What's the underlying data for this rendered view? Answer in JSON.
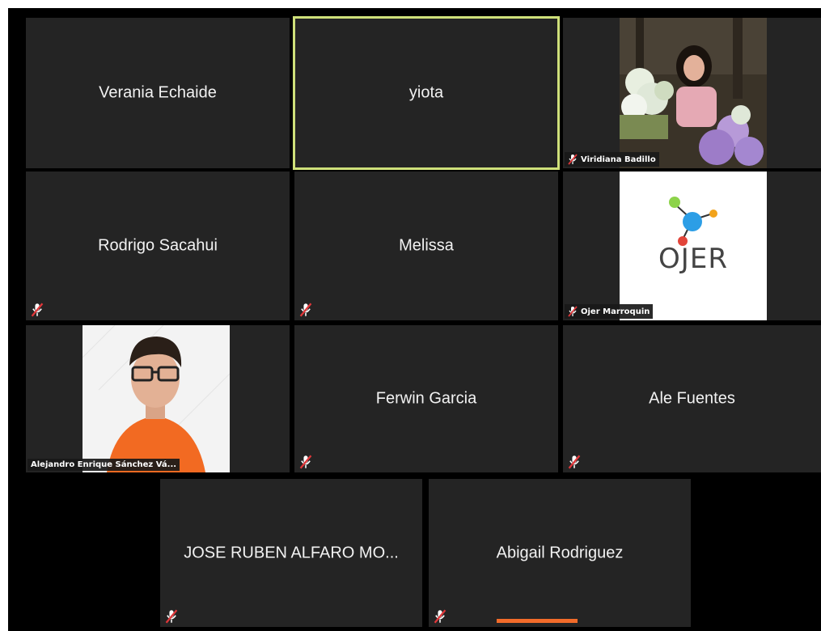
{
  "participants": [
    {
      "name": "Verania Echaide"
    },
    {
      "name": "yiota"
    },
    {
      "name": "Viridiana Badillo"
    },
    {
      "name": "Rodrigo Sacahui"
    },
    {
      "name": "Melissa"
    },
    {
      "name": "Ojer Marroquin",
      "logo_text": "OJER"
    },
    {
      "name": "Alejandro Enrique Sánchez Vá..."
    },
    {
      "name": "Ferwin Garcia"
    },
    {
      "name": "Ale Fuentes"
    },
    {
      "name": "JOSE RUBEN ALFARO MO..."
    },
    {
      "name": "Abigail Rodriguez"
    }
  ],
  "colors": {
    "tile_bg": "#242424",
    "active_speaker_border": "#cfe07a",
    "muted_icon": "#e0373a",
    "accent_bar": "#f26b2a"
  },
  "icons": {
    "muted": "muted-microphone-icon"
  }
}
